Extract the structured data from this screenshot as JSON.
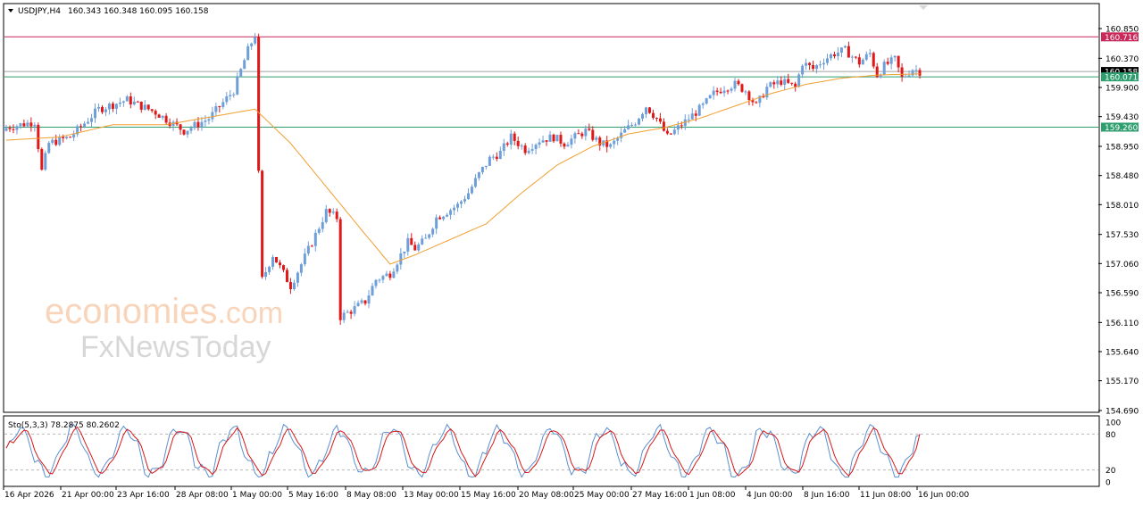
{
  "header": {
    "symbol_tf": "USDJPY,H4",
    "ohlc": "160.343 160.348 160.095 160.158"
  },
  "watermark": {
    "brand1_main": "economies",
    "brand1_tld": ".com",
    "brand2": "FxNewsToday"
  },
  "stoch_header": "Sto(5,3,3) 78.2875 80.2602",
  "colors": {
    "bull": "#6f9fd8",
    "bear": "#e01818",
    "ma": "#f0a030",
    "resistance": "#c8285a",
    "support": "#2f9e6e",
    "current": "#000000",
    "stoch_main": "#5b8fd0",
    "stoch_signal": "#d81818"
  },
  "chart_data": {
    "type": "candlestick",
    "symbol": "USDJPY",
    "timeframe": "H4",
    "price_axis_ticks": [
      "160.850",
      "160.370",
      "159.900",
      "159.430",
      "158.950",
      "158.480",
      "158.010",
      "157.530",
      "157.060",
      "156.590",
      "156.110",
      "155.640",
      "155.170",
      "154.690"
    ],
    "ylim": [
      154.69,
      160.85
    ],
    "levels": [
      {
        "label": "160.716",
        "value": 160.716,
        "role": "resistance"
      },
      {
        "label": "160.158",
        "value": 160.158,
        "role": "current"
      },
      {
        "label": "160.071",
        "value": 160.071,
        "role": "support"
      },
      {
        "label": "159.260",
        "value": 159.26,
        "role": "support"
      }
    ],
    "x_tick_labels": [
      "16 Apr 2026",
      "21 Apr 00:00",
      "23 Apr 16:00",
      "28 Apr 08:00",
      "1 May 00:00",
      "5 May 16:00",
      "8 May 08:00",
      "13 May 00:00",
      "15 May 16:00",
      "20 May 08:00",
      "25 May 00:00",
      "27 May 16:00",
      "1 Jun 08:00",
      "4 Jun 00:00",
      "8 Jun 16:00",
      "11 Jun 08:00",
      "16 Jun 00:00"
    ],
    "close_path": [
      [
        0,
        159.25
      ],
      [
        8,
        159.35
      ],
      [
        10,
        158.55
      ],
      [
        12,
        159.0
      ],
      [
        18,
        159.1
      ],
      [
        26,
        159.55
      ],
      [
        34,
        159.7
      ],
      [
        42,
        159.5
      ],
      [
        50,
        159.2
      ],
      [
        57,
        159.4
      ],
      [
        64,
        159.85
      ],
      [
        68,
        160.5
      ],
      [
        70,
        160.75
      ],
      [
        71,
        158.5
      ],
      [
        72,
        156.8
      ],
      [
        75,
        157.2
      ],
      [
        80,
        156.7
      ],
      [
        86,
        157.4
      ],
      [
        90,
        157.9
      ],
      [
        93,
        157.8
      ],
      [
        94,
        156.2
      ],
      [
        97,
        156.3
      ],
      [
        101,
        156.45
      ],
      [
        104,
        156.8
      ],
      [
        108,
        156.9
      ],
      [
        111,
        157.2
      ],
      [
        113,
        157.4
      ],
      [
        115,
        157.3
      ],
      [
        118,
        157.45
      ],
      [
        121,
        157.8
      ],
      [
        127,
        158.0
      ],
      [
        130,
        158.2
      ],
      [
        133,
        158.5
      ],
      [
        136,
        158.75
      ],
      [
        139,
        158.85
      ],
      [
        142,
        159.1
      ],
      [
        146,
        158.9
      ],
      [
        150,
        159.05
      ],
      [
        154,
        159.1
      ],
      [
        157,
        159.0
      ],
      [
        160,
        159.1
      ],
      [
        163,
        159.2
      ],
      [
        167,
        159.0
      ],
      [
        170,
        158.95
      ],
      [
        174,
        159.2
      ],
      [
        177,
        159.35
      ],
      [
        180,
        159.6
      ],
      [
        183,
        159.4
      ],
      [
        186,
        159.1
      ],
      [
        190,
        159.3
      ],
      [
        193,
        159.45
      ],
      [
        196,
        159.6
      ],
      [
        199,
        159.8
      ],
      [
        202,
        159.9
      ],
      [
        205,
        159.95
      ],
      [
        208,
        159.85
      ],
      [
        211,
        159.6
      ],
      [
        214,
        159.9
      ],
      [
        218,
        160.0
      ],
      [
        222,
        159.9
      ],
      [
        224,
        160.3
      ],
      [
        227,
        160.2
      ],
      [
        230,
        160.35
      ],
      [
        233,
        160.45
      ],
      [
        236,
        160.5
      ],
      [
        240,
        160.3
      ],
      [
        243,
        160.45
      ],
      [
        245,
        160.1
      ],
      [
        247,
        160.25
      ],
      [
        250,
        160.35
      ],
      [
        252,
        160.05
      ],
      [
        255,
        160.2
      ],
      [
        257,
        160.16
      ]
    ],
    "ma_path": [
      [
        0,
        159.05
      ],
      [
        15,
        159.1
      ],
      [
        30,
        159.3
      ],
      [
        45,
        159.3
      ],
      [
        60,
        159.45
      ],
      [
        70,
        159.55
      ],
      [
        80,
        159.0
      ],
      [
        90,
        158.3
      ],
      [
        100,
        157.6
      ],
      [
        108,
        157.05
      ],
      [
        115,
        157.2
      ],
      [
        125,
        157.45
      ],
      [
        135,
        157.7
      ],
      [
        145,
        158.2
      ],
      [
        155,
        158.65
      ],
      [
        165,
        158.95
      ],
      [
        175,
        159.15
      ],
      [
        185,
        159.25
      ],
      [
        195,
        159.4
      ],
      [
        205,
        159.6
      ],
      [
        215,
        159.8
      ],
      [
        225,
        159.95
      ],
      [
        235,
        160.05
      ],
      [
        245,
        160.1
      ],
      [
        257,
        160.12
      ]
    ],
    "candle_count": 258,
    "seed": 7,
    "stochastic": {
      "k_period": 5,
      "d_period": 3,
      "slowing": 3,
      "main_last": 78.2875,
      "signal_last": 80.2602,
      "levels": [
        20,
        80
      ],
      "ylim": [
        0,
        100
      ],
      "ticks": [
        "100",
        "80",
        "20",
        "0"
      ]
    }
  }
}
